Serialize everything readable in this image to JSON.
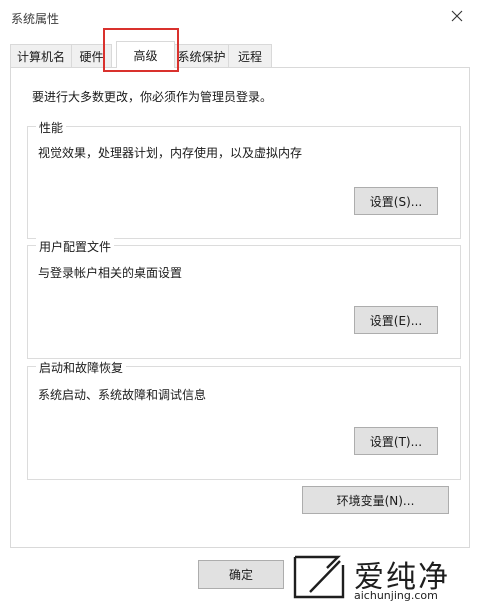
{
  "window": {
    "title": "系统属性"
  },
  "tabs": [
    {
      "label": "计算机名",
      "active": false
    },
    {
      "label": "硬件",
      "active": false
    },
    {
      "label": "高级",
      "active": true
    },
    {
      "label": "系统保护",
      "active": false
    },
    {
      "label": "远程",
      "active": false
    }
  ],
  "highlight_color": "#d9312d",
  "intro_text": "要进行大多数更改，你必须作为管理员登录。",
  "groups": {
    "performance": {
      "title": "性能",
      "description": "视觉效果，处理器计划，内存使用，以及虚拟内存",
      "button": "设置(S)..."
    },
    "user_profiles": {
      "title": "用户配置文件",
      "description": "与登录帐户相关的桌面设置",
      "button": "设置(E)..."
    },
    "startup_recovery": {
      "title": "启动和故障恢复",
      "description": "系统启动、系统故障和调试信息",
      "button": "设置(T)..."
    }
  },
  "env_button": "环境变量(N)...",
  "footer": {
    "ok_label": "确定"
  },
  "watermark": {
    "brand": "爱纯净",
    "url": "aichunjing.com"
  }
}
